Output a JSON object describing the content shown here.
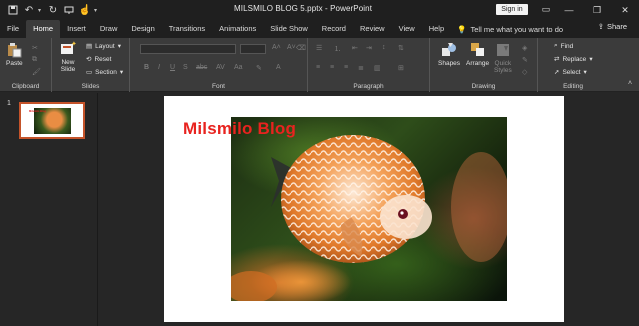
{
  "window": {
    "doc_title": "MILSMILO BLOG 5.pptx  -  PowerPoint",
    "sign_in": "Sign in",
    "share": "Share"
  },
  "tabs": [
    "File",
    "Home",
    "Insert",
    "Draw",
    "Design",
    "Transitions",
    "Animations",
    "Slide Show",
    "Record",
    "Review",
    "View",
    "Help"
  ],
  "active_tab": "Home",
  "tell_me": "Tell me what you want to do",
  "ribbon": {
    "clipboard": {
      "label": "Clipboard",
      "paste": "Paste"
    },
    "slides": {
      "label": "Slides",
      "new_slide_1": "New",
      "new_slide_2": "Slide",
      "layout": "Layout",
      "reset": "Reset",
      "section": "Section"
    },
    "font": {
      "label": "Font"
    },
    "paragraph": {
      "label": "Paragraph"
    },
    "drawing": {
      "label": "Drawing",
      "shapes": "Shapes",
      "arrange": "Arrange",
      "quick_1": "Quick",
      "quick_2": "Styles"
    },
    "editing": {
      "label": "Editing",
      "find": "Find",
      "replace": "Replace",
      "select": "Select"
    }
  },
  "thumbnails": [
    {
      "number": "1"
    }
  ],
  "slide": {
    "title": "Milsmilo Blog"
  },
  "colors": {
    "accent": "#c4532a",
    "title_red": "#e8231f",
    "ribbon_bg": "#3b3b3b",
    "titlebar_bg": "#1f1f1f"
  }
}
